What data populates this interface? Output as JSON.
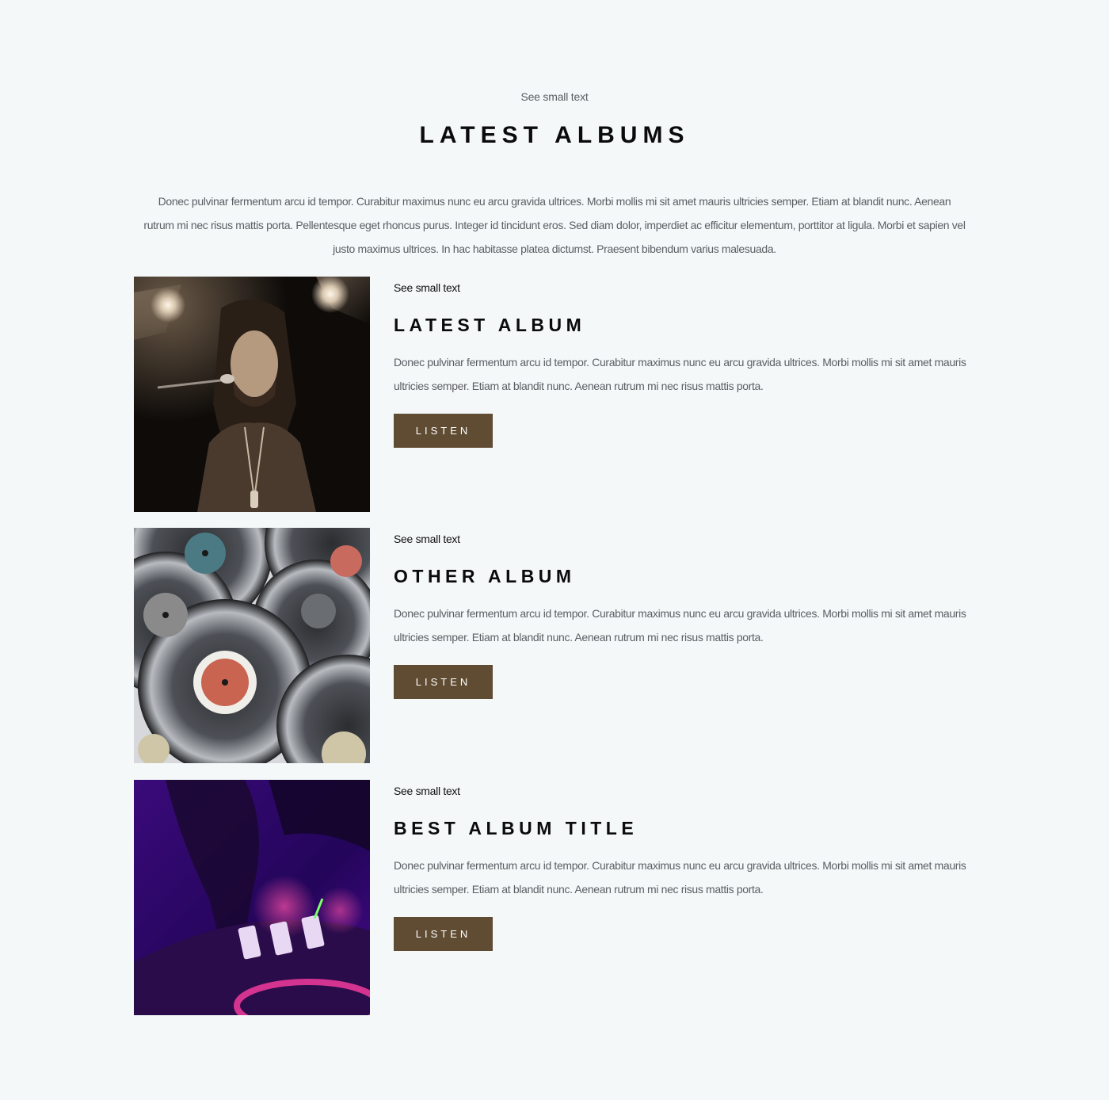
{
  "header": {
    "kicker": "See small text",
    "title": "LATEST ALBUMS",
    "intro": "Donec pulvinar fermentum arcu id tempor. Curabitur maximus nunc eu arcu gravida ultrices. Morbi mollis mi sit amet mauris ultricies semper. Etiam at blandit nunc. Aenean rutrum mi nec risus mattis porta. Pellentesque eget rhoncus purus. Integer id tincidunt eros. Sed diam dolor, imperdiet ac efficitur elementum, porttitor at ligula. Morbi et sapien vel justo maximus ultrices. In hac habitasse platea dictumst. Praesent bibendum varius malesuada."
  },
  "albums": [
    {
      "kicker": "See small text",
      "title": "LATEST ALBUM",
      "description": "Donec pulvinar fermentum arcu id tempor. Curabitur maximus nunc eu arcu gravida ultrices. Morbi mollis mi sit amet mauris ultricies semper. Etiam at blandit nunc. Aenean rutrum mi nec risus mattis porta.",
      "button_label": "LISTEN"
    },
    {
      "kicker": "See small text",
      "title": "OTHER ALBUM",
      "description": "Donec pulvinar fermentum arcu id tempor. Curabitur maximus nunc eu arcu gravida ultrices. Morbi mollis mi sit amet mauris ultricies semper. Etiam at blandit nunc. Aenean rutrum mi nec risus mattis porta.",
      "button_label": "LISTEN"
    },
    {
      "kicker": "See small text",
      "title": "BEST ALBUM TITLE",
      "description": "Donec pulvinar fermentum arcu id tempor. Curabitur maximus nunc eu arcu gravida ultrices. Morbi mollis mi sit amet mauris ultricies semper. Etiam at blandit nunc. Aenean rutrum mi nec risus mattis porta.",
      "button_label": "LISTEN"
    }
  ],
  "colors": {
    "background": "#f4f8f9",
    "button": "#604c33",
    "button_text": "#ffffff",
    "heading": "#0b0b0b",
    "body_text": "#5b5e63"
  }
}
